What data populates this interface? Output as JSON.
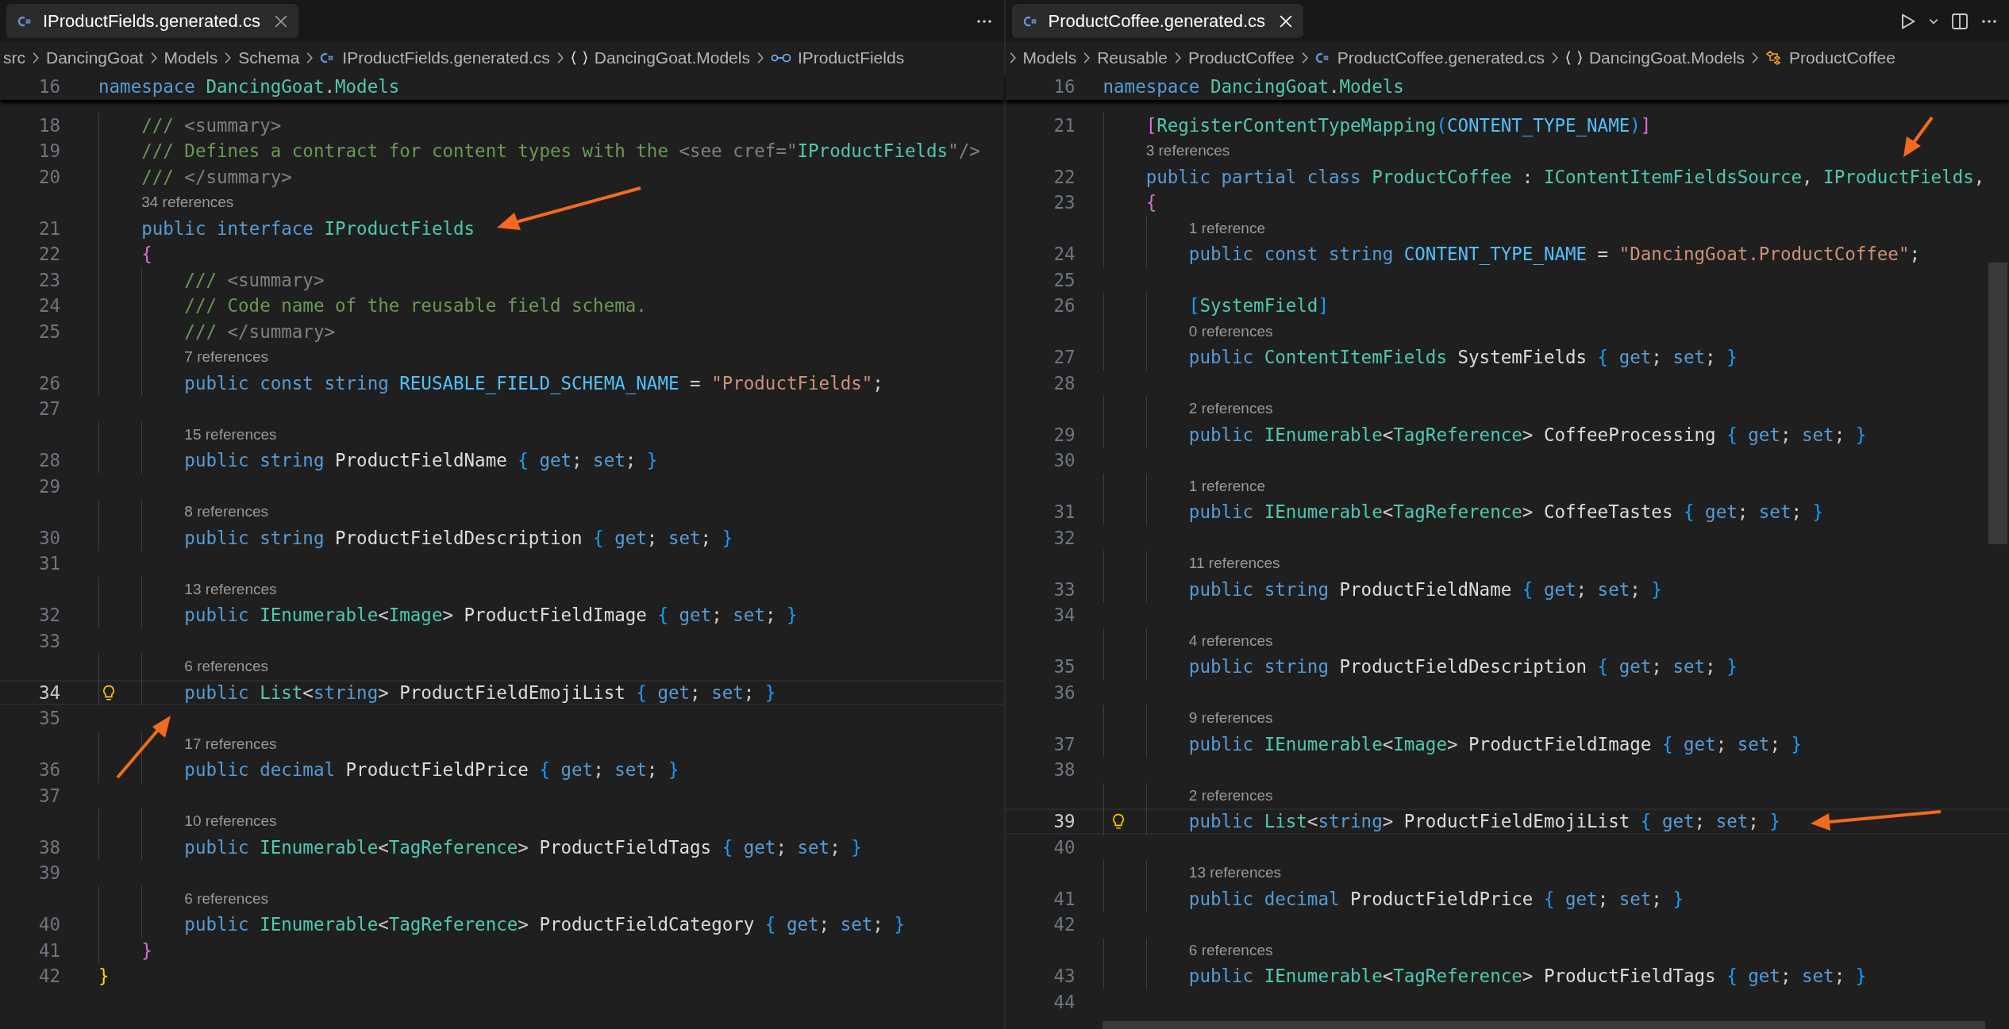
{
  "panes": [
    {
      "focused": false,
      "tab": {
        "title": "IProductFields.generated.cs",
        "selected": true
      },
      "actions": [
        {
          "kind": "more"
        }
      ],
      "breadcrumbs": [
        {
          "label": "src",
          "kind": "folder"
        },
        {
          "label": "DancingGoat",
          "kind": "folder"
        },
        {
          "label": "Models",
          "kind": "folder"
        },
        {
          "label": "Schema",
          "kind": "folder"
        },
        {
          "label": "IProductFields.generated.cs",
          "kind": "file"
        },
        {
          "label": "DancingGoat.Models",
          "kind": "namespace"
        },
        {
          "label": "IProductFields",
          "kind": "interface"
        }
      ],
      "sticky": {
        "number": "16",
        "tokens": [
          {
            "text": "namespace ",
            "kind": "kw"
          },
          {
            "text": "DancingGoat",
            "kind": "type"
          },
          {
            "text": ".",
            "kind": "punct"
          },
          {
            "text": "Models",
            "kind": "type"
          }
        ]
      },
      "lines": [
        {
          "kind": "code",
          "number": "18",
          "current": false,
          "tokens": [
            {
              "text": "    /// ",
              "kind": "comment"
            },
            {
              "text": "<summary>",
              "kind": "xml"
            }
          ]
        },
        {
          "kind": "code",
          "number": "19",
          "current": false,
          "tokens": [
            {
              "text": "    /// Defines a contract for content types with the ",
              "kind": "comment"
            },
            {
              "text": "<see cref=\"",
              "kind": "xml"
            },
            {
              "text": "IProductFields",
              "kind": "cref"
            },
            {
              "text": "\"/>",
              "kind": "xml"
            }
          ]
        },
        {
          "kind": "code",
          "number": "20",
          "current": false,
          "tokens": [
            {
              "text": "    /// ",
              "kind": "comment"
            },
            {
              "text": "</summary>",
              "kind": "xml"
            }
          ]
        },
        {
          "kind": "lens",
          "text": "    34 references"
        },
        {
          "kind": "code",
          "number": "21",
          "current": false,
          "tokens": [
            {
              "text": "    public interface ",
              "kind": "kw"
            },
            {
              "text": "IProductFields",
              "kind": "type"
            }
          ]
        },
        {
          "kind": "code",
          "number": "22",
          "current": false,
          "tokens": [
            {
              "text": "    {",
              "kind": "brace2"
            }
          ]
        },
        {
          "kind": "code",
          "number": "23",
          "current": false,
          "tokens": [
            {
              "text": "        /// ",
              "kind": "comment"
            },
            {
              "text": "<summary>",
              "kind": "xml"
            }
          ]
        },
        {
          "kind": "code",
          "number": "24",
          "current": false,
          "tokens": [
            {
              "text": "        /// Code name of the reusable field schema.",
              "kind": "comment"
            }
          ]
        },
        {
          "kind": "code",
          "number": "25",
          "current": false,
          "tokens": [
            {
              "text": "        /// ",
              "kind": "comment"
            },
            {
              "text": "</summary>",
              "kind": "xml"
            }
          ]
        },
        {
          "kind": "lens",
          "text": "        7 references"
        },
        {
          "kind": "code",
          "number": "26",
          "current": false,
          "tokens": [
            {
              "text": "        public const string ",
              "kind": "kw"
            },
            {
              "text": "REUSABLE_FIELD_SCHEMA_NAME",
              "kind": "const"
            },
            {
              "text": " = ",
              "kind": "punct"
            },
            {
              "text": "\"ProductFields\"",
              "kind": "string"
            },
            {
              "text": ";",
              "kind": "punct"
            }
          ]
        },
        {
          "kind": "code",
          "number": "27",
          "current": false
        },
        {
          "kind": "lens",
          "text": "        15 references"
        },
        {
          "kind": "code",
          "number": "28",
          "current": false,
          "tokens": [
            {
              "text": "        public string ",
              "kind": "kw"
            },
            {
              "text": "ProductFieldName",
              "kind": "ident"
            },
            {
              "text": " {",
              "kind": "brace3"
            },
            {
              "text": " get",
              "kind": "kw"
            },
            {
              "text": ";",
              "kind": "punct"
            },
            {
              "text": " set",
              "kind": "kw"
            },
            {
              "text": ";",
              "kind": "punct"
            },
            {
              "text": " }",
              "kind": "brace3"
            }
          ]
        },
        {
          "kind": "code",
          "number": "29",
          "current": false
        },
        {
          "kind": "lens",
          "text": "        8 references"
        },
        {
          "kind": "code",
          "number": "30",
          "current": false,
          "tokens": [
            {
              "text": "        public string ",
              "kind": "kw"
            },
            {
              "text": "ProductFieldDescription",
              "kind": "ident"
            },
            {
              "text": " {",
              "kind": "brace3"
            },
            {
              "text": " get",
              "kind": "kw"
            },
            {
              "text": ";",
              "kind": "punct"
            },
            {
              "text": " set",
              "kind": "kw"
            },
            {
              "text": ";",
              "kind": "punct"
            },
            {
              "text": " }",
              "kind": "brace3"
            }
          ]
        },
        {
          "kind": "code",
          "number": "31",
          "current": false
        },
        {
          "kind": "lens",
          "text": "        13 references"
        },
        {
          "kind": "code",
          "number": "32",
          "current": false,
          "tokens": [
            {
              "text": "        public ",
              "kind": "kw"
            },
            {
              "text": "IEnumerable",
              "kind": "type"
            },
            {
              "text": "<",
              "kind": "punct"
            },
            {
              "text": "Image",
              "kind": "type"
            },
            {
              "text": "> ",
              "kind": "punct"
            },
            {
              "text": "ProductFieldImage",
              "kind": "ident"
            },
            {
              "text": " {",
              "kind": "brace3"
            },
            {
              "text": " get",
              "kind": "kw"
            },
            {
              "text": ";",
              "kind": "punct"
            },
            {
              "text": " set",
              "kind": "kw"
            },
            {
              "text": ";",
              "kind": "punct"
            },
            {
              "text": " }",
              "kind": "brace3"
            }
          ]
        },
        {
          "kind": "code",
          "number": "33",
          "current": false
        },
        {
          "kind": "lens",
          "text": "        6 references"
        },
        {
          "kind": "code",
          "number": "34",
          "current": true,
          "tokens": [
            {
              "text": "        public ",
              "kind": "kw"
            },
            {
              "text": "List",
              "kind": "type"
            },
            {
              "text": "<",
              "kind": "punct"
            },
            {
              "text": "string",
              "kind": "kw"
            },
            {
              "text": "> ",
              "kind": "punct"
            },
            {
              "text": "ProductFieldEmojiList",
              "kind": "ident"
            },
            {
              "text": " {",
              "kind": "brace3"
            },
            {
              "text": " get",
              "kind": "kw"
            },
            {
              "text": ";",
              "kind": "punct"
            },
            {
              "text": " set",
              "kind": "kw"
            },
            {
              "text": ";",
              "kind": "punct"
            },
            {
              "text": " }",
              "kind": "brace3"
            }
          ]
        },
        {
          "kind": "code",
          "number": "35",
          "current": false
        },
        {
          "kind": "lens",
          "text": "        17 references"
        },
        {
          "kind": "code",
          "number": "36",
          "current": false,
          "tokens": [
            {
              "text": "        public decimal ",
              "kind": "kw"
            },
            {
              "text": "ProductFieldPrice",
              "kind": "ident"
            },
            {
              "text": " {",
              "kind": "brace3"
            },
            {
              "text": " get",
              "kind": "kw"
            },
            {
              "text": ";",
              "kind": "punct"
            },
            {
              "text": " set",
              "kind": "kw"
            },
            {
              "text": ";",
              "kind": "punct"
            },
            {
              "text": " }",
              "kind": "brace3"
            }
          ]
        },
        {
          "kind": "code",
          "number": "37",
          "current": false
        },
        {
          "kind": "lens",
          "text": "        10 references"
        },
        {
          "kind": "code",
          "number": "38",
          "current": false,
          "tokens": [
            {
              "text": "        public ",
              "kind": "kw"
            },
            {
              "text": "IEnumerable",
              "kind": "type"
            },
            {
              "text": "<",
              "kind": "punct"
            },
            {
              "text": "TagReference",
              "kind": "type"
            },
            {
              "text": "> ",
              "kind": "punct"
            },
            {
              "text": "ProductFieldTags",
              "kind": "ident"
            },
            {
              "text": " {",
              "kind": "brace3"
            },
            {
              "text": " get",
              "kind": "kw"
            },
            {
              "text": ";",
              "kind": "punct"
            },
            {
              "text": " set",
              "kind": "kw"
            },
            {
              "text": ";",
              "kind": "punct"
            },
            {
              "text": " }",
              "kind": "brace3"
            }
          ]
        },
        {
          "kind": "code",
          "number": "39",
          "current": false
        },
        {
          "kind": "lens",
          "text": "        6 references"
        },
        {
          "kind": "code",
          "number": "40",
          "current": false,
          "tokens": [
            {
              "text": "        public ",
              "kind": "kw"
            },
            {
              "text": "IEnumerable",
              "kind": "type"
            },
            {
              "text": "<",
              "kind": "punct"
            },
            {
              "text": "TagReference",
              "kind": "type"
            },
            {
              "text": "> ",
              "kind": "punct"
            },
            {
              "text": "ProductFieldCategory",
              "kind": "ident"
            },
            {
              "text": " {",
              "kind": "brace3"
            },
            {
              "text": " get",
              "kind": "kw"
            },
            {
              "text": ";",
              "kind": "punct"
            },
            {
              "text": " set",
              "kind": "kw"
            },
            {
              "text": ";",
              "kind": "punct"
            },
            {
              "text": " }",
              "kind": "brace3"
            }
          ]
        },
        {
          "kind": "code",
          "number": "41",
          "current": false,
          "tokens": [
            {
              "text": "    }",
              "kind": "brace2"
            }
          ]
        },
        {
          "kind": "code",
          "number": "42",
          "current": false,
          "tokens": [
            {
              "text": "}",
              "kind": "brace1"
            }
          ]
        }
      ]
    },
    {
      "focused": true,
      "tab": {
        "title": "ProductCoffee.generated.cs",
        "selected": true
      },
      "actions": [
        {
          "kind": "run"
        },
        {
          "kind": "dropdown"
        },
        {
          "kind": "split"
        },
        {
          "kind": "more"
        }
      ],
      "breadcrumbs": [
        {
          "label": "Models",
          "kind": "folder"
        },
        {
          "label": "Reusable",
          "kind": "folder"
        },
        {
          "label": "ProductCoffee",
          "kind": "folder"
        },
        {
          "label": "ProductCoffee.generated.cs",
          "kind": "file"
        },
        {
          "label": "DancingGoat.Models",
          "kind": "namespace"
        },
        {
          "label": "ProductCoffee",
          "kind": "class"
        }
      ],
      "sticky": {
        "number": "16",
        "tokens": [
          {
            "text": "namespace ",
            "kind": "kw"
          },
          {
            "text": "DancingGoat",
            "kind": "type"
          },
          {
            "text": ".",
            "kind": "punct"
          },
          {
            "text": "Models",
            "kind": "type"
          }
        ]
      },
      "lines": [
        {
          "kind": "code",
          "number": "21",
          "current": false,
          "tokens": [
            {
              "text": "    [",
              "kind": "brace2"
            },
            {
              "text": "RegisterContentTypeMapping",
              "kind": "type"
            },
            {
              "text": "(",
              "kind": "brace3"
            },
            {
              "text": "CONTENT_TYPE_NAME",
              "kind": "const"
            },
            {
              "text": ")",
              "kind": "brace3"
            },
            {
              "text": "]",
              "kind": "brace2"
            }
          ]
        },
        {
          "kind": "lens",
          "text": "    3 references"
        },
        {
          "kind": "code",
          "number": "22",
          "current": false,
          "tokens": [
            {
              "text": "    public partial class ",
              "kind": "kw"
            },
            {
              "text": "ProductCoffee",
              "kind": "type"
            },
            {
              "text": " : ",
              "kind": "punct"
            },
            {
              "text": "IContentItemFieldsSource",
              "kind": "type"
            },
            {
              "text": ", ",
              "kind": "punct"
            },
            {
              "text": "IProductFields",
              "kind": "type"
            },
            {
              "text": ",",
              "kind": "punct"
            }
          ]
        },
        {
          "kind": "code",
          "number": "23",
          "current": false,
          "tokens": [
            {
              "text": "    {",
              "kind": "brace2"
            }
          ]
        },
        {
          "kind": "lens",
          "text": "        1 reference"
        },
        {
          "kind": "code",
          "number": "24",
          "current": false,
          "tokens": [
            {
              "text": "        public const string ",
              "kind": "kw"
            },
            {
              "text": "CONTENT_TYPE_NAME",
              "kind": "const"
            },
            {
              "text": " = ",
              "kind": "punct"
            },
            {
              "text": "\"DancingGoat.ProductCoffee\"",
              "kind": "string"
            },
            {
              "text": ";",
              "kind": "punct"
            }
          ]
        },
        {
          "kind": "code",
          "number": "25",
          "current": false
        },
        {
          "kind": "code",
          "number": "26",
          "current": false,
          "tokens": [
            {
              "text": "        [",
              "kind": "brace3"
            },
            {
              "text": "SystemField",
              "kind": "type"
            },
            {
              "text": "]",
              "kind": "brace3"
            }
          ]
        },
        {
          "kind": "lens",
          "text": "        0 references"
        },
        {
          "kind": "code",
          "number": "27",
          "current": false,
          "tokens": [
            {
              "text": "        public ",
              "kind": "kw"
            },
            {
              "text": "ContentItemFields",
              "kind": "type"
            },
            {
              "text": " SystemFields",
              "kind": "ident"
            },
            {
              "text": " {",
              "kind": "brace3"
            },
            {
              "text": " get",
              "kind": "kw"
            },
            {
              "text": ";",
              "kind": "punct"
            },
            {
              "text": " set",
              "kind": "kw"
            },
            {
              "text": ";",
              "kind": "punct"
            },
            {
              "text": " }",
              "kind": "brace3"
            }
          ]
        },
        {
          "kind": "code",
          "number": "28",
          "current": false
        },
        {
          "kind": "lens",
          "text": "        2 references"
        },
        {
          "kind": "code",
          "number": "29",
          "current": false,
          "tokens": [
            {
              "text": "        public ",
              "kind": "kw"
            },
            {
              "text": "IEnumerable",
              "kind": "type"
            },
            {
              "text": "<",
              "kind": "punct"
            },
            {
              "text": "TagReference",
              "kind": "type"
            },
            {
              "text": "> ",
              "kind": "punct"
            },
            {
              "text": "CoffeeProcessing",
              "kind": "ident"
            },
            {
              "text": " {",
              "kind": "brace3"
            },
            {
              "text": " get",
              "kind": "kw"
            },
            {
              "text": ";",
              "kind": "punct"
            },
            {
              "text": " set",
              "kind": "kw"
            },
            {
              "text": ";",
              "kind": "punct"
            },
            {
              "text": " }",
              "kind": "brace3"
            }
          ]
        },
        {
          "kind": "code",
          "number": "30",
          "current": false
        },
        {
          "kind": "lens",
          "text": "        1 reference"
        },
        {
          "kind": "code",
          "number": "31",
          "current": false,
          "tokens": [
            {
              "text": "        public ",
              "kind": "kw"
            },
            {
              "text": "IEnumerable",
              "kind": "type"
            },
            {
              "text": "<",
              "kind": "punct"
            },
            {
              "text": "TagReference",
              "kind": "type"
            },
            {
              "text": "> ",
              "kind": "punct"
            },
            {
              "text": "CoffeeTastes",
              "kind": "ident"
            },
            {
              "text": " {",
              "kind": "brace3"
            },
            {
              "text": " get",
              "kind": "kw"
            },
            {
              "text": ";",
              "kind": "punct"
            },
            {
              "text": " set",
              "kind": "kw"
            },
            {
              "text": ";",
              "kind": "punct"
            },
            {
              "text": " }",
              "kind": "brace3"
            }
          ]
        },
        {
          "kind": "code",
          "number": "32",
          "current": false
        },
        {
          "kind": "lens",
          "text": "        11 references"
        },
        {
          "kind": "code",
          "number": "33",
          "current": false,
          "tokens": [
            {
              "text": "        public string ",
              "kind": "kw"
            },
            {
              "text": "ProductFieldName",
              "kind": "ident"
            },
            {
              "text": " {",
              "kind": "brace3"
            },
            {
              "text": " get",
              "kind": "kw"
            },
            {
              "text": ";",
              "kind": "punct"
            },
            {
              "text": " set",
              "kind": "kw"
            },
            {
              "text": ";",
              "kind": "punct"
            },
            {
              "text": " }",
              "kind": "brace3"
            }
          ]
        },
        {
          "kind": "code",
          "number": "34",
          "current": false
        },
        {
          "kind": "lens",
          "text": "        4 references"
        },
        {
          "kind": "code",
          "number": "35",
          "current": false,
          "tokens": [
            {
              "text": "        public string ",
              "kind": "kw"
            },
            {
              "text": "ProductFieldDescription",
              "kind": "ident"
            },
            {
              "text": " {",
              "kind": "brace3"
            },
            {
              "text": " get",
              "kind": "kw"
            },
            {
              "text": ";",
              "kind": "punct"
            },
            {
              "text": " set",
              "kind": "kw"
            },
            {
              "text": ";",
              "kind": "punct"
            },
            {
              "text": " }",
              "kind": "brace3"
            }
          ]
        },
        {
          "kind": "code",
          "number": "36",
          "current": false
        },
        {
          "kind": "lens",
          "text": "        9 references"
        },
        {
          "kind": "code",
          "number": "37",
          "current": false,
          "tokens": [
            {
              "text": "        public ",
              "kind": "kw"
            },
            {
              "text": "IEnumerable",
              "kind": "type"
            },
            {
              "text": "<",
              "kind": "punct"
            },
            {
              "text": "Image",
              "kind": "type"
            },
            {
              "text": "> ",
              "kind": "punct"
            },
            {
              "text": "ProductFieldImage",
              "kind": "ident"
            },
            {
              "text": " {",
              "kind": "brace3"
            },
            {
              "text": " get",
              "kind": "kw"
            },
            {
              "text": ";",
              "kind": "punct"
            },
            {
              "text": " set",
              "kind": "kw"
            },
            {
              "text": ";",
              "kind": "punct"
            },
            {
              "text": " }",
              "kind": "brace3"
            }
          ]
        },
        {
          "kind": "code",
          "number": "38",
          "current": false
        },
        {
          "kind": "lens",
          "text": "        2 references"
        },
        {
          "kind": "code",
          "number": "39",
          "current": true,
          "tokens": [
            {
              "text": "        public ",
              "kind": "kw"
            },
            {
              "text": "List",
              "kind": "type"
            },
            {
              "text": "<",
              "kind": "punct"
            },
            {
              "text": "string",
              "kind": "kw"
            },
            {
              "text": "> ",
              "kind": "punct"
            },
            {
              "text": "ProductFieldEmojiList",
              "kind": "ident"
            },
            {
              "text": " {",
              "kind": "brace3"
            },
            {
              "text": " get",
              "kind": "kw"
            },
            {
              "text": ";",
              "kind": "punct"
            },
            {
              "text": " set",
              "kind": "kw"
            },
            {
              "text": ";",
              "kind": "punct"
            },
            {
              "text": " }",
              "kind": "brace3"
            }
          ]
        },
        {
          "kind": "code",
          "number": "40",
          "current": false
        },
        {
          "kind": "lens",
          "text": "        13 references"
        },
        {
          "kind": "code",
          "number": "41",
          "current": false,
          "tokens": [
            {
              "text": "        public decimal ",
              "kind": "kw"
            },
            {
              "text": "ProductFieldPrice",
              "kind": "ident"
            },
            {
              "text": " {",
              "kind": "brace3"
            },
            {
              "text": " get",
              "kind": "kw"
            },
            {
              "text": ";",
              "kind": "punct"
            },
            {
              "text": " set",
              "kind": "kw"
            },
            {
              "text": ";",
              "kind": "punct"
            },
            {
              "text": " }",
              "kind": "brace3"
            }
          ]
        },
        {
          "kind": "code",
          "number": "42",
          "current": false
        },
        {
          "kind": "lens",
          "text": "        6 references"
        },
        {
          "kind": "code",
          "number": "43",
          "current": false,
          "tokens": [
            {
              "text": "        public ",
              "kind": "kw"
            },
            {
              "text": "IEnumerable",
              "kind": "type"
            },
            {
              "text": "<",
              "kind": "punct"
            },
            {
              "text": "TagReference",
              "kind": "type"
            },
            {
              "text": "> ",
              "kind": "punct"
            },
            {
              "text": "ProductFieldTags",
              "kind": "ident"
            },
            {
              "text": " {",
              "kind": "brace3"
            },
            {
              "text": " get",
              "kind": "kw"
            },
            {
              "text": ";",
              "kind": "punct"
            },
            {
              "text": " set",
              "kind": "kw"
            },
            {
              "text": ";",
              "kind": "punct"
            },
            {
              "text": " }",
              "kind": "brace3"
            }
          ]
        },
        {
          "kind": "code",
          "number": "44",
          "current": false
        }
      ]
    }
  ]
}
